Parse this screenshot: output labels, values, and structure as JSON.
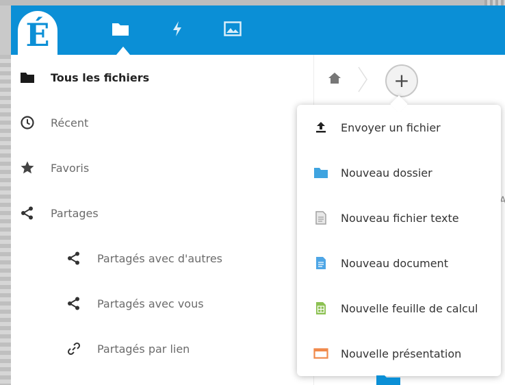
{
  "header": {
    "logo_text": "É",
    "nav": [
      {
        "name": "files",
        "icon": "folder-icon"
      },
      {
        "name": "activity",
        "icon": "lightning-icon"
      },
      {
        "name": "gallery",
        "icon": "image-icon"
      }
    ],
    "brand_color": "#0b8fd6"
  },
  "sidebar": {
    "items": [
      {
        "label": "Tous les fichiers",
        "icon": "folder-icon",
        "active": true
      },
      {
        "label": "Récent",
        "icon": "clock-icon"
      },
      {
        "label": "Favoris",
        "icon": "star-icon"
      },
      {
        "label": "Partages",
        "icon": "share-icon"
      },
      {
        "label": "Partagés avec d'autres",
        "icon": "share-icon"
      },
      {
        "label": "Partagés avec vous",
        "icon": "share-icon"
      },
      {
        "label": "Partagés par lien",
        "icon": "link-icon"
      }
    ]
  },
  "content": {
    "add_label": "+",
    "peek_char": "A"
  },
  "new_menu": {
    "items": [
      {
        "label": "Envoyer un fichier",
        "icon": "upload-icon"
      },
      {
        "label": "Nouveau dossier",
        "icon": "folder-icon",
        "color": "#3fa4e0"
      },
      {
        "label": "Nouveau fichier texte",
        "icon": "text-file-icon",
        "color": "#a0a0a0"
      },
      {
        "label": "Nouveau document",
        "icon": "document-icon",
        "color": "#4ea6e6"
      },
      {
        "label": "Nouvelle feuille de calcul",
        "icon": "spreadsheet-icon",
        "color": "#8cc152"
      },
      {
        "label": "Nouvelle présentation",
        "icon": "presentation-icon",
        "color": "#f08a4b"
      }
    ]
  }
}
